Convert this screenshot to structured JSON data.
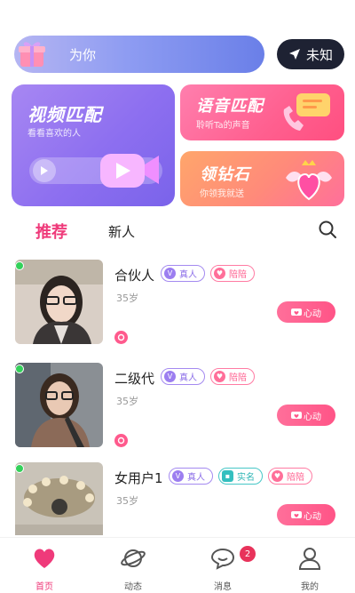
{
  "header": {
    "for_you_label": "为你",
    "location_label": "未知"
  },
  "cards": {
    "video": {
      "title": "视频匹配",
      "subtitle": "看看喜欢的人"
    },
    "voice": {
      "title": "语音匹配",
      "subtitle": "聆听Ta的声音"
    },
    "diamond": {
      "title": "领钻石",
      "subtitle": "你领我就送"
    }
  },
  "tabs": {
    "recommend": "推荐",
    "new": "新人"
  },
  "users": [
    {
      "name": "合伙人",
      "age": "35岁",
      "badges": [
        "真人",
        "陪陪"
      ],
      "like_label": "心动",
      "online": true
    },
    {
      "name": "二级代",
      "age": "35岁",
      "badges": [
        "真人",
        "陪陪"
      ],
      "like_label": "心动",
      "online": true
    },
    {
      "name": "女用户1",
      "age": "35岁",
      "badges": [
        "真人",
        "实名",
        "陪陪"
      ],
      "like_label": "心动",
      "online": true
    }
  ],
  "nav": {
    "items": [
      {
        "label": "首页",
        "icon": "heart-icon",
        "active": true
      },
      {
        "label": "动态",
        "icon": "planet-icon",
        "active": false
      },
      {
        "label": "消息",
        "icon": "chat-bubble-icon",
        "active": false
      },
      {
        "label": "我的",
        "icon": "person-icon",
        "active": false
      }
    ],
    "message_count": "2"
  },
  "colors": {
    "accent": "#ef3a7a",
    "online": "#33d15a",
    "real_badge": "#8c6fe8",
    "id_badge": "#2fb6b6",
    "accompany_badge": "#ff5f8f"
  }
}
